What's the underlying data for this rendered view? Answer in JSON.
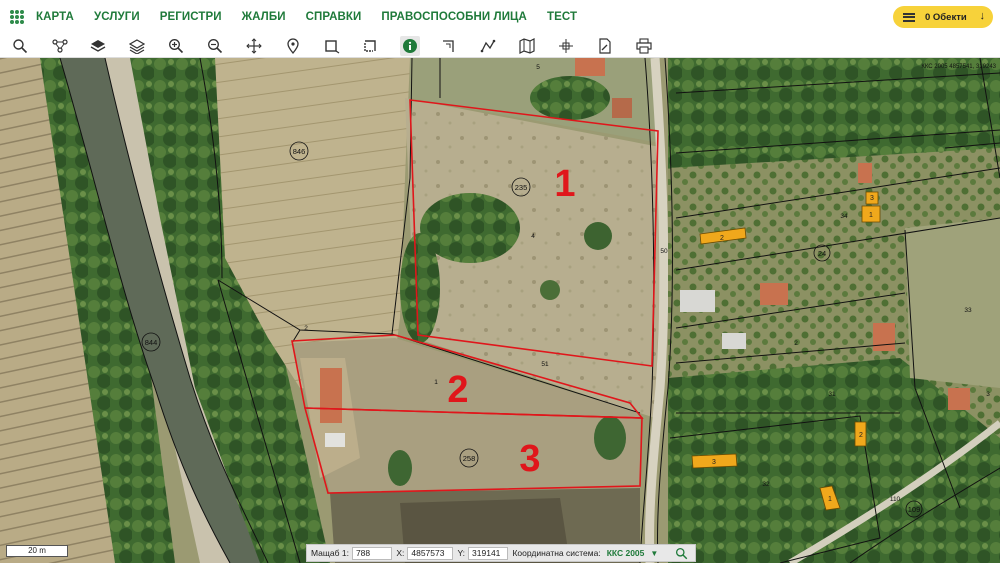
{
  "nav": {
    "items": [
      "КАРТА",
      "УСЛУГИ",
      "РЕГИСТРИ",
      "ЖАЛБИ",
      "СПРАВКИ",
      "ПРАВОСПОСОБНИ ЛИЦА",
      "ТЕСТ"
    ],
    "objects_label": "0 Обекти"
  },
  "colors": {
    "accent": "#1f7a3a",
    "objects_button": "#f7d23a",
    "parcel_outline": "#e0161b",
    "parcel_number": "#e0161b",
    "building": "#f0a81c"
  },
  "toolbar": {
    "icons": [
      "search-icon",
      "network-icon",
      "layers-filled-icon",
      "layers-outline-icon",
      "zoom-in-icon",
      "zoom-out-icon",
      "pan-icon",
      "location-pin-icon",
      "rectangle-select-icon",
      "rectangle-select-alt-icon",
      "info-icon",
      "measure-area-icon",
      "measure-line-icon",
      "map-icon",
      "coordinates-icon",
      "edit-document-icon",
      "print-icon"
    ],
    "active": "info-icon"
  },
  "map": {
    "parcel_labels": [
      {
        "id": "1",
        "name": "parcel-label-1"
      },
      {
        "id": "2",
        "name": "parcel-label-2"
      },
      {
        "id": "3",
        "name": "parcel-label-3"
      }
    ],
    "circled_numbers": [
      "846",
      "844",
      "235",
      "258",
      "24",
      "109"
    ],
    "small_numbers": [
      "5",
      "2",
      "1",
      "51",
      "50",
      "4",
      "33",
      "34",
      "31",
      "32",
      "110",
      "2",
      "3"
    ],
    "building_numbers": [
      "2",
      "3",
      "1",
      "2",
      "3",
      "1"
    ],
    "corner_text": "ККС 2005 4857541, 319243"
  },
  "status": {
    "scale_bar_label": "20 m",
    "scale_label": "Мащаб 1:",
    "scale_value": "788",
    "x_label": "X:",
    "x_value": "4857573",
    "y_label": "Y:",
    "y_value": "319141",
    "crs_label": "Координатна система:",
    "crs_value": "ККС 2005",
    "caret": "▼"
  }
}
